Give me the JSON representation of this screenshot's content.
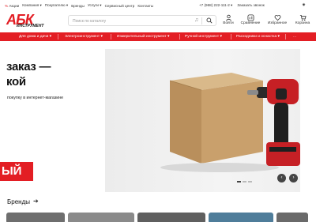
{
  "topbar": {
    "nav": [
      {
        "label": "Акции",
        "icon": "percent-icon"
      },
      {
        "label": "Компания",
        "caret": true
      },
      {
        "label": "Покупателю",
        "caret": true
      },
      {
        "label": "Бренды"
      },
      {
        "label": "Услуги",
        "caret": true
      },
      {
        "label": "Сервисный центр"
      },
      {
        "label": "Контакты"
      }
    ],
    "phone": "+7 (968) 222-111-2",
    "callback": "Заказать звонок"
  },
  "header": {
    "logo_text": "АБК",
    "logo_sub": "ИНСТРУМЕНТ",
    "search_placeholder": "Поиск по каталогу",
    "icons": [
      {
        "label": "Войти",
        "icon": "user-icon"
      },
      {
        "label": "Сравнение",
        "icon": "compare-icon"
      },
      {
        "label": "Избранное",
        "icon": "heart-icon"
      },
      {
        "label": "Корзина",
        "icon": "cart-icon"
      }
    ]
  },
  "menu": {
    "items": [
      "Для дома и дачи",
      "Электроинструмент",
      "Измерительный инструмент",
      "Ручной инструмент",
      "Расходники и оснастка"
    ],
    "more": "..."
  },
  "hero": {
    "line1": "заказ —",
    "line2": "кой",
    "sub": "покупку в интернет-магазине",
    "button": "ЫЙ"
  },
  "brands": {
    "title": "Бренды",
    "items": [
      "brand-1",
      "brand-2",
      "brand-3",
      "brand-4",
      "brand-5"
    ]
  },
  "colors": {
    "accent": "#e31e24",
    "dark": "#222222"
  }
}
